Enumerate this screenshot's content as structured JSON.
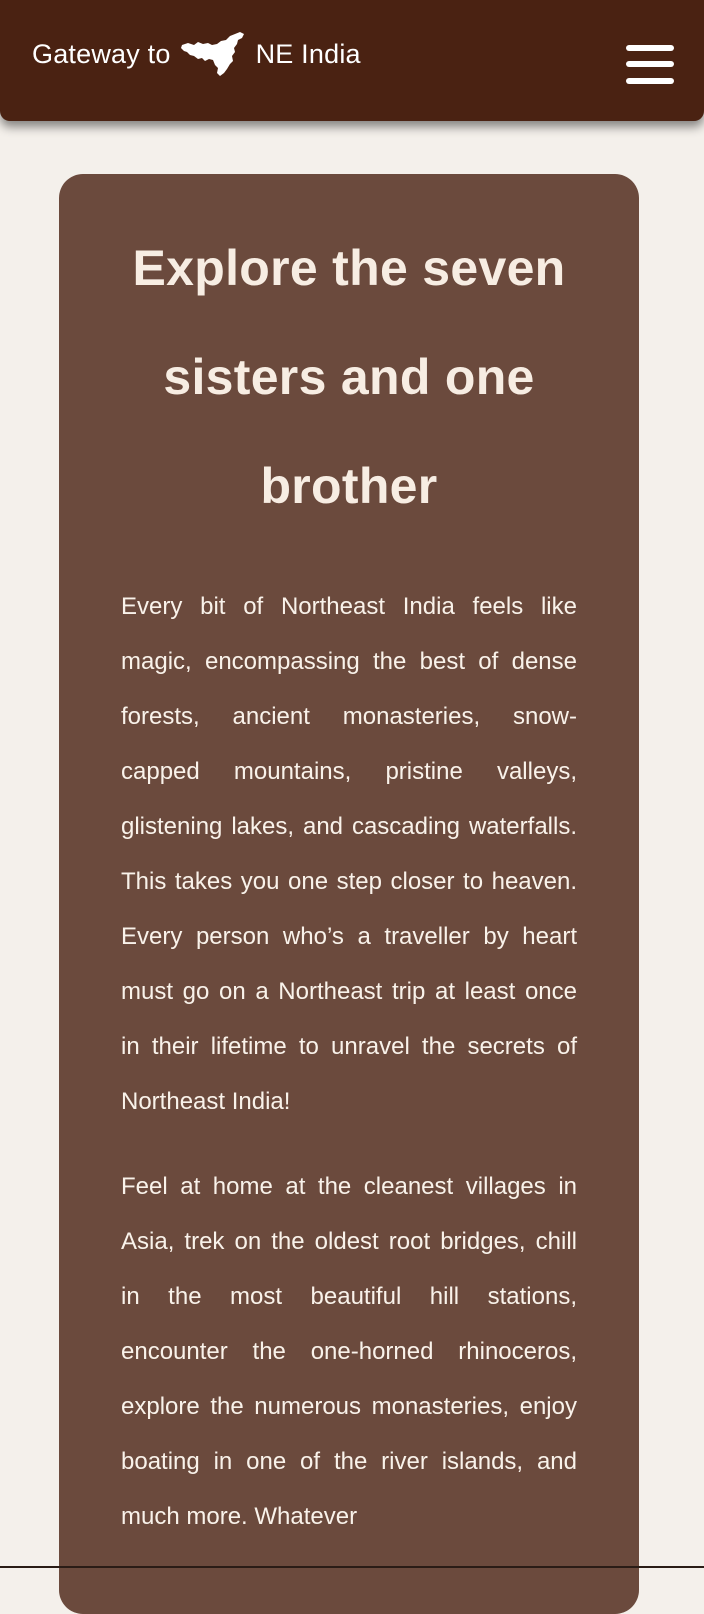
{
  "header": {
    "brand_prefix": "Gateway to",
    "brand_suffix": "NE India",
    "logo_icon": "northeast-india-map-icon",
    "menu_icon": "hamburger-menu-icon",
    "background_color": "#4a2212"
  },
  "main": {
    "heading": "Explore the seven sisters and one brother",
    "paragraphs": [
      "Every bit of Northeast India feels like magic, encompassing the best of dense forests, ancient monasteries, snow-capped mountains, pristine valleys, glistening lakes, and cascading waterfalls. This takes you one step closer to heaven. Every person who’s a traveller by heart must go on a Northeast trip at least once in their lifetime to unravel the secrets of Northeast India!",
      "Feel at home at the cleanest villages in Asia, trek on the oldest root bridges, chill in the most beautiful hill stations, encounter the one-horned rhinoceros, explore the numerous monasteries, enjoy boating in one of the river islands, and much more. Whatever"
    ],
    "card_color": "#6b4a3d",
    "page_background": "#f4f0eb"
  }
}
